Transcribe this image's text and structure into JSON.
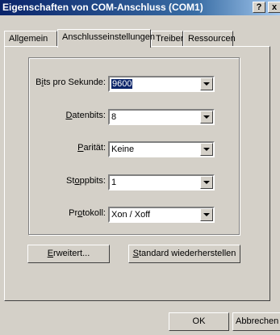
{
  "window": {
    "title": "Eigenschaften von COM-Anschluss (COM1)",
    "help_label": "?",
    "close_label": "x"
  },
  "tabs": [
    {
      "label": "Allgemein"
    },
    {
      "label": "Anschlusseinstellungen"
    },
    {
      "label": "Treiber"
    },
    {
      "label": "Ressourcen"
    }
  ],
  "settings": {
    "bits": {
      "pre": "B",
      "ul": "i",
      "post": "ts pro Sekunde:",
      "value": "9600"
    },
    "datenbits": {
      "pre": "",
      "ul": "D",
      "post": "atenbits:",
      "value": "8"
    },
    "paritaet": {
      "pre": "",
      "ul": "P",
      "post": "arität:",
      "value": "Keine"
    },
    "stoppbits": {
      "pre": "St",
      "ul": "o",
      "post": "ppbits:",
      "value": "1"
    },
    "protokoll": {
      "pre": "Pr",
      "ul": "o",
      "post": "tokoll:",
      "value": "Xon / Xoff"
    }
  },
  "buttons": {
    "erweitert": {
      "ul": "E",
      "rest": "rweitert..."
    },
    "standard": {
      "ul": "S",
      "rest": "tandard wiederherstellen"
    },
    "ok": "OK",
    "abbrechen": "Abbrechen"
  }
}
